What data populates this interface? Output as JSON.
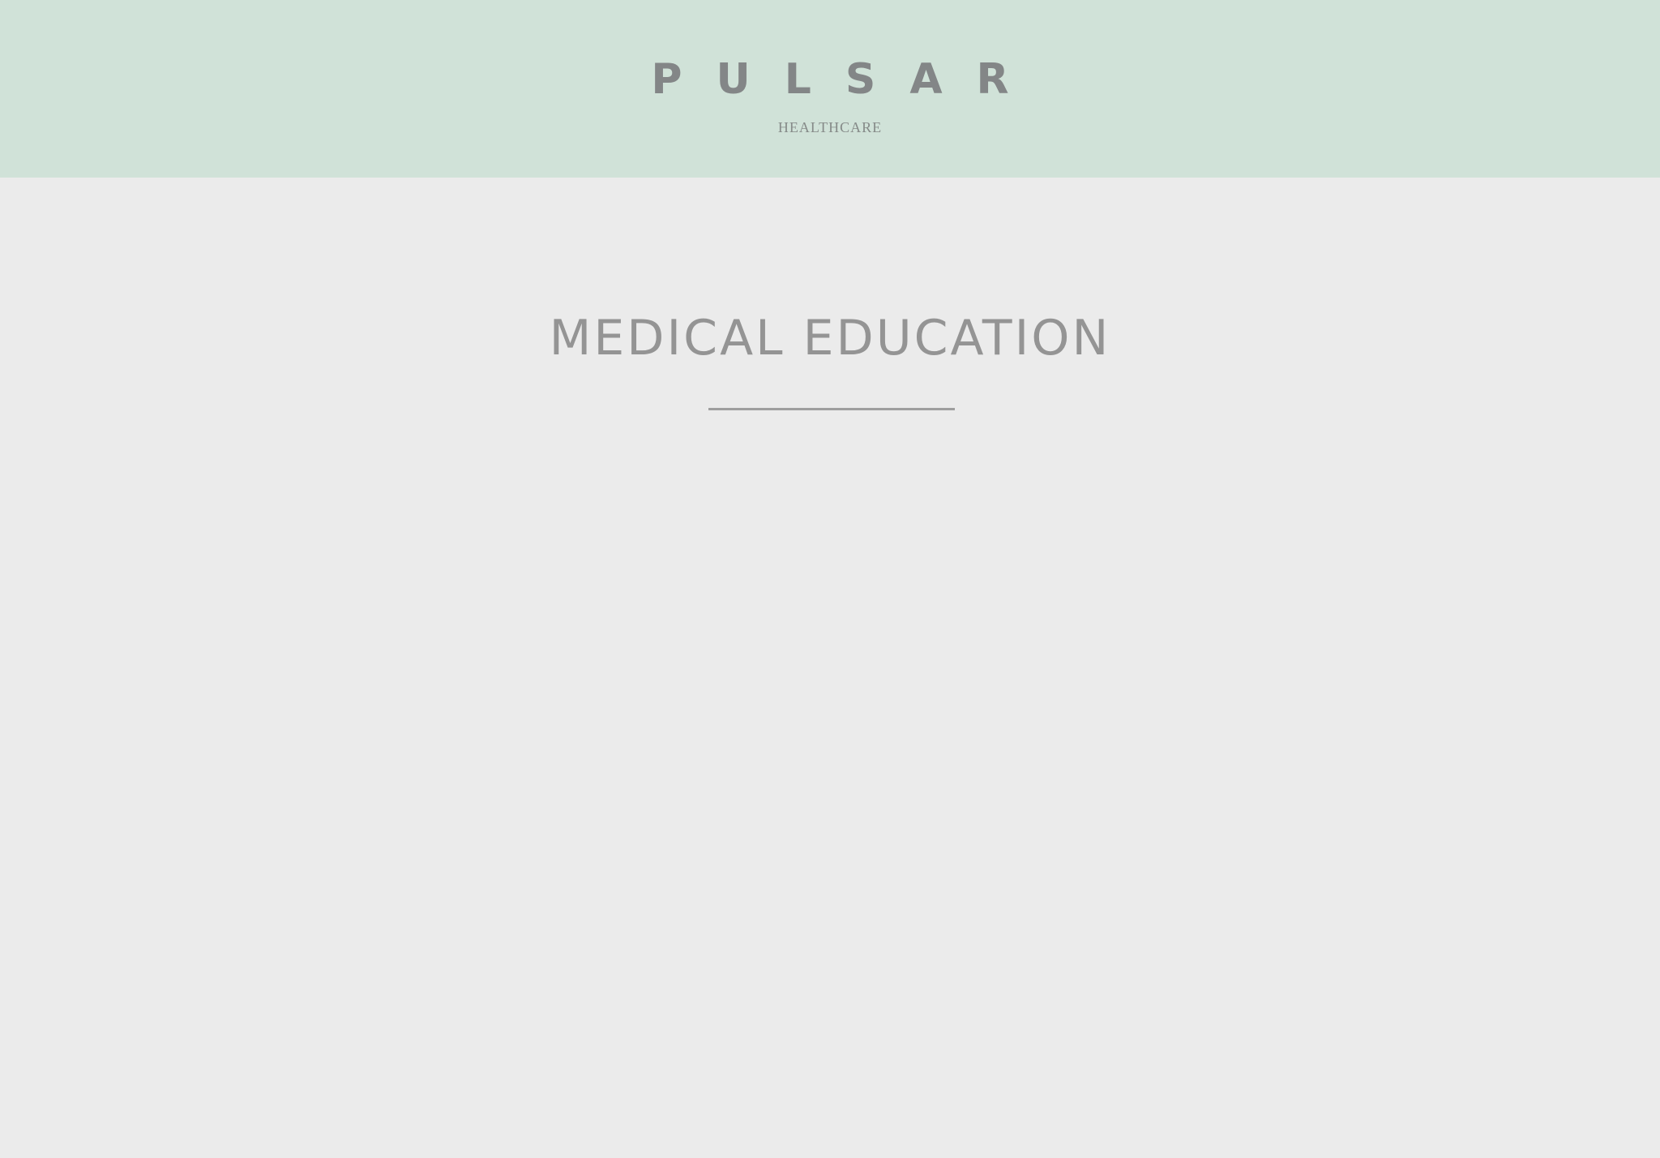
{
  "header": {
    "brand_name": "PULSAR",
    "brand_tagline": "HEALTHCARE"
  },
  "main": {
    "section_title": "MEDICAL EDUCATION"
  },
  "colors": {
    "header_background": "#d0e2d8",
    "page_background": "#ebebeb",
    "brand_text": "#838687",
    "title_text": "#949494",
    "divider": "#9e9e9e"
  }
}
